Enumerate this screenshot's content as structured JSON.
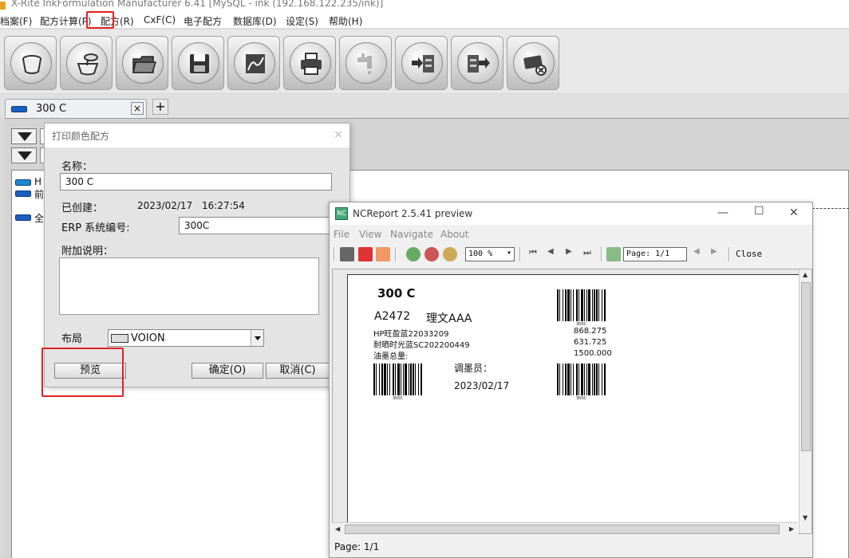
{
  "window_title": "X-Rite InkFormulation Manufacturer 6.41    [MySQL - ink (192.168.122.235/ink)]",
  "menu": [
    "档案(F)",
    "配方计算(P)",
    "配方(R)",
    "CxF(C)",
    "电子配方",
    "数据库(D)",
    "设定(S)",
    "帮助(H)"
  ],
  "toolbar": [
    "cup-icon",
    "pour-icon",
    "folder-open-icon",
    "save-icon",
    "chart-icon",
    "print-icon",
    "tap-icon",
    "import-icon",
    "export-icon",
    "card-delete-icon"
  ],
  "tab": {
    "label": "300 C",
    "close": "×",
    "add": "+"
  },
  "left_panel": {
    "row1": "H",
    "row2": "前",
    "row3": "全"
  },
  "dialog": {
    "title": "打印颜色配方",
    "close": "×",
    "name_label": "名称：",
    "name_value": "300 C",
    "created_label": "已创建：",
    "created_date": "2023/02/17",
    "created_time": "16:27:54",
    "erp_label": "ERP 系统编号:",
    "erp_value": "300C",
    "note_label": "附加说明：",
    "layout_label": "布局",
    "layout_value": "VOION",
    "preview_btn": "预览",
    "ok_btn": "确定(O)",
    "cancel_btn": "取消(C)"
  },
  "preview": {
    "title": "NCReport 2.5.41  preview",
    "menu": [
      "File",
      "View",
      "Navigate",
      "About"
    ],
    "zoom": "100 %",
    "page_box": "Page: 1/1",
    "close": "Close",
    "status": "Page: 1/1",
    "report": {
      "title": "300 C",
      "code": "A2472",
      "name": "理文AAA",
      "ink1": "HP旺盈蓝22033209",
      "ink1_qty": "868.275",
      "ink2": "耐晒时光蓝SC202200449",
      "ink2_qty": "631.725",
      "total_label": "油墨总量:",
      "total_qty": "1500.000",
      "operator_label": "调墨员：",
      "date": "2023/02/17",
      "barcode_caption": "300C"
    }
  },
  "colors": {
    "accent_red": "#e02020",
    "swatch_blue": "#1a5fc0"
  }
}
